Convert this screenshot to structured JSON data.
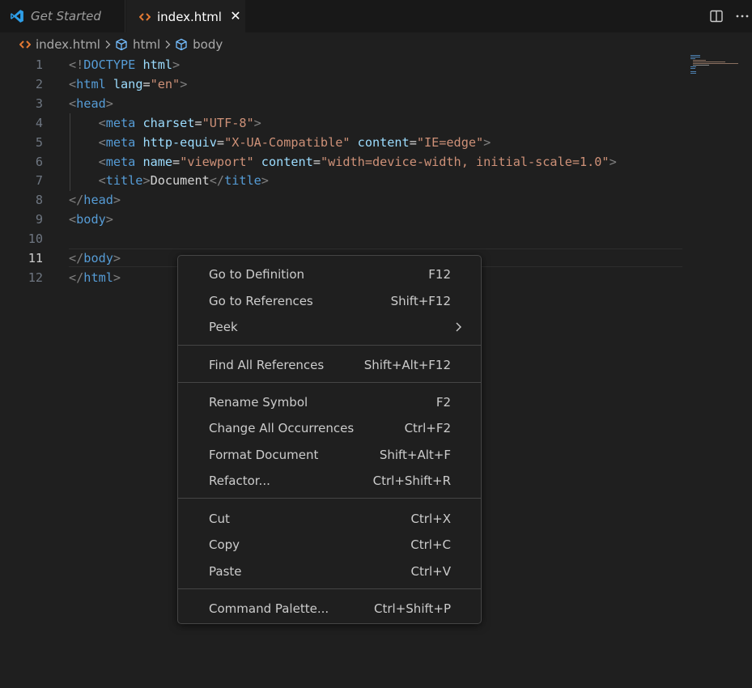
{
  "tabs": [
    {
      "label": "Get Started",
      "icon": "vscode-logo-icon",
      "active": false
    },
    {
      "label": "index.html",
      "icon": "html-file-icon",
      "active": true
    }
  ],
  "breadcrumb": [
    {
      "label": "index.html",
      "icon": "html-file-icon"
    },
    {
      "label": "html",
      "icon": "symbol-cube-icon"
    },
    {
      "label": "body",
      "icon": "symbol-cube-icon"
    }
  ],
  "editor": {
    "active_line": 11,
    "line_numbers": [
      "1",
      "2",
      "3",
      "4",
      "5",
      "6",
      "7",
      "8",
      "9",
      "10",
      "11",
      "12"
    ],
    "lines": [
      [
        {
          "t": "<!",
          "c": "punct"
        },
        {
          "t": "DOCTYPE",
          "c": "tag"
        },
        {
          "t": " ",
          "c": "txt"
        },
        {
          "t": "html",
          "c": "attr"
        },
        {
          "t": ">",
          "c": "punct"
        }
      ],
      [
        {
          "t": "<",
          "c": "punct"
        },
        {
          "t": "html",
          "c": "tag"
        },
        {
          "t": " ",
          "c": "txt"
        },
        {
          "t": "lang",
          "c": "attr"
        },
        {
          "t": "=",
          "c": "txt"
        },
        {
          "t": "\"en\"",
          "c": "str"
        },
        {
          "t": ">",
          "c": "punct"
        }
      ],
      [
        {
          "t": "<",
          "c": "punct"
        },
        {
          "t": "head",
          "c": "tag"
        },
        {
          "t": ">",
          "c": "punct"
        }
      ],
      [
        {
          "t": "    ",
          "c": "txt"
        },
        {
          "t": "<",
          "c": "punct"
        },
        {
          "t": "meta",
          "c": "tag"
        },
        {
          "t": " ",
          "c": "txt"
        },
        {
          "t": "charset",
          "c": "attr"
        },
        {
          "t": "=",
          "c": "txt"
        },
        {
          "t": "\"UTF-8\"",
          "c": "str"
        },
        {
          "t": ">",
          "c": "punct"
        }
      ],
      [
        {
          "t": "    ",
          "c": "txt"
        },
        {
          "t": "<",
          "c": "punct"
        },
        {
          "t": "meta",
          "c": "tag"
        },
        {
          "t": " ",
          "c": "txt"
        },
        {
          "t": "http-equiv",
          "c": "attr"
        },
        {
          "t": "=",
          "c": "txt"
        },
        {
          "t": "\"X-UA-Compatible\"",
          "c": "str"
        },
        {
          "t": " ",
          "c": "txt"
        },
        {
          "t": "content",
          "c": "attr"
        },
        {
          "t": "=",
          "c": "txt"
        },
        {
          "t": "\"IE=edge\"",
          "c": "str"
        },
        {
          "t": ">",
          "c": "punct"
        }
      ],
      [
        {
          "t": "    ",
          "c": "txt"
        },
        {
          "t": "<",
          "c": "punct"
        },
        {
          "t": "meta",
          "c": "tag"
        },
        {
          "t": " ",
          "c": "txt"
        },
        {
          "t": "name",
          "c": "attr"
        },
        {
          "t": "=",
          "c": "txt"
        },
        {
          "t": "\"viewport\"",
          "c": "str"
        },
        {
          "t": " ",
          "c": "txt"
        },
        {
          "t": "content",
          "c": "attr"
        },
        {
          "t": "=",
          "c": "txt"
        },
        {
          "t": "\"width=device-width, initial-scale=1.0\"",
          "c": "str"
        },
        {
          "t": ">",
          "c": "punct"
        }
      ],
      [
        {
          "t": "    ",
          "c": "txt"
        },
        {
          "t": "<",
          "c": "punct"
        },
        {
          "t": "title",
          "c": "tag"
        },
        {
          "t": ">",
          "c": "punct"
        },
        {
          "t": "Document",
          "c": "txt"
        },
        {
          "t": "</",
          "c": "punct"
        },
        {
          "t": "title",
          "c": "tag"
        },
        {
          "t": ">",
          "c": "punct"
        }
      ],
      [
        {
          "t": "</",
          "c": "punct"
        },
        {
          "t": "head",
          "c": "tag"
        },
        {
          "t": ">",
          "c": "punct"
        }
      ],
      [
        {
          "t": "<",
          "c": "punct"
        },
        {
          "t": "body",
          "c": "tag"
        },
        {
          "t": ">",
          "c": "punct"
        }
      ],
      [],
      [
        {
          "t": "</",
          "c": "punct"
        },
        {
          "t": "body",
          "c": "tag"
        },
        {
          "t": ">",
          "c": "punct"
        }
      ],
      [
        {
          "t": "</",
          "c": "punct"
        },
        {
          "t": "html",
          "c": "tag"
        },
        {
          "t": ">",
          "c": "punct"
        }
      ]
    ]
  },
  "context_menu": {
    "groups": [
      [
        {
          "label": "Go to Definition",
          "shortcut": "F12"
        },
        {
          "label": "Go to References",
          "shortcut": "Shift+F12"
        },
        {
          "label": "Peek",
          "shortcut": "",
          "submenu": true
        }
      ],
      [
        {
          "label": "Find All References",
          "shortcut": "Shift+Alt+F12"
        }
      ],
      [
        {
          "label": "Rename Symbol",
          "shortcut": "F2"
        },
        {
          "label": "Change All Occurrences",
          "shortcut": "Ctrl+F2"
        },
        {
          "label": "Format Document",
          "shortcut": "Shift+Alt+F"
        },
        {
          "label": "Refactor...",
          "shortcut": "Ctrl+Shift+R"
        }
      ],
      [
        {
          "label": "Cut",
          "shortcut": "Ctrl+X"
        },
        {
          "label": "Copy",
          "shortcut": "Ctrl+C"
        },
        {
          "label": "Paste",
          "shortcut": "Ctrl+V"
        }
      ],
      [
        {
          "label": "Command Palette...",
          "shortcut": "Ctrl+Shift+P"
        }
      ]
    ]
  },
  "colors": {
    "accent": "#0078d4",
    "html_icon": "#e37933",
    "tag": "#569cd6",
    "attribute": "#9cdcfe",
    "string": "#ce9178"
  }
}
